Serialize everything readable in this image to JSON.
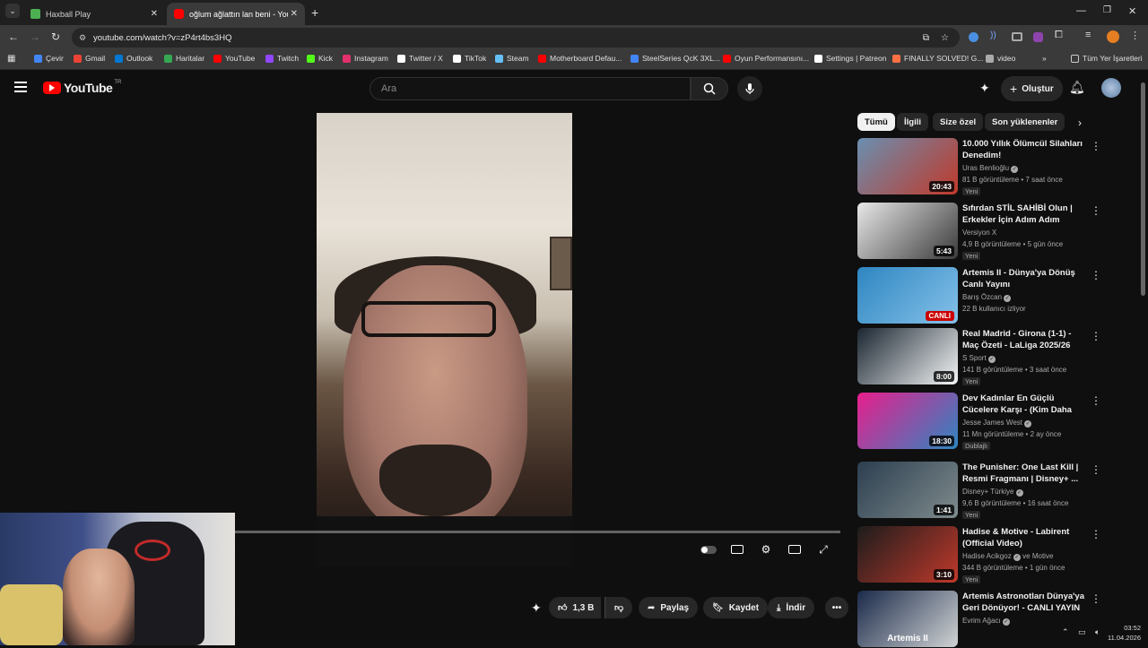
{
  "browser": {
    "tabs": [
      {
        "title": "Haxball Play",
        "color": "#4caf50"
      },
      {
        "title": "oğlum ağlattın lan beni - YouTube",
        "color": "#ff0000"
      }
    ],
    "url": "youtube.com/watch?v=zP4rt4bs3HQ",
    "bookmarks": [
      {
        "label": "Çevir",
        "color": "#4285f4"
      },
      {
        "label": "Gmail",
        "color": "#ea4335"
      },
      {
        "label": "Outlook",
        "color": "#0078d4"
      },
      {
        "label": "Haritalar",
        "color": "#34a853"
      },
      {
        "label": "YouTube",
        "color": "#ff0000"
      },
      {
        "label": "Twitch",
        "color": "#9146ff"
      },
      {
        "label": "Kick",
        "color": "#53fc18"
      },
      {
        "label": "Instagram",
        "color": "#e1306c"
      },
      {
        "label": "Twitter / X",
        "color": "#ffffff"
      },
      {
        "label": "TikTok",
        "color": "#ffffff"
      },
      {
        "label": "Steam",
        "color": "#66c0f4"
      },
      {
        "label": "Motherboard Defau...",
        "color": "#ff0000"
      },
      {
        "label": "SteelSeries QcK 3XL...",
        "color": "#4285f4"
      },
      {
        "label": "Oyun Performansını...",
        "color": "#ff0000"
      },
      {
        "label": "Settings | Patreon",
        "color": "#ffffff"
      },
      {
        "label": "FINALLY SOLVED! G...",
        "color": "#ff7043"
      },
      {
        "label": "video",
        "color": "#aaaaaa"
      }
    ],
    "all_bookmarks": "Tüm Yer İşaretleri",
    "more_bookmarks": "»"
  },
  "youtube": {
    "logo": "YouTube",
    "region": "TR",
    "search_placeholder": "Ara",
    "create_label": "Oluştur"
  },
  "video": {
    "like_count": "1,3 B",
    "share_label": "Paylaş",
    "save_label": "Kaydet",
    "download_label": "İndir",
    "progress": 0.0
  },
  "chips": [
    "Tümü",
    "İlgili",
    "Size özel",
    "Son yüklenenler"
  ],
  "recommendations": [
    {
      "title": "10.000 Yıllık Ölümcül Silahları Denedim!",
      "channel": "Uras Benlioğlu",
      "verified": true,
      "meta": "81 B görüntüleme • 7 saat önce",
      "badge": "Yeni",
      "duration": "20:43",
      "thumb_a": "#6a8fb0",
      "thumb_b": "#c0392b"
    },
    {
      "title": "Sıfırdan STİL SAHİBİ Olun | Erkekler İçin Adım Adım Giyim...",
      "channel": "Versiyon X",
      "verified": false,
      "meta": "4,9 B görüntüleme • 5 gün önce",
      "badge": "Yeni",
      "duration": "5:43",
      "thumb_a": "#e8e8e8",
      "thumb_b": "#3a3a3a"
    },
    {
      "title": "Artemis II - Dünya'ya Dönüş Canlı Yayını",
      "channel": "Barış Özcan",
      "verified": true,
      "meta": "22 B kullanıcı izliyor",
      "badge": "",
      "live": "CANLI",
      "thumb_a": "#2e86c1",
      "thumb_b": "#85c1e9"
    },
    {
      "title": "Real Madrid - Girona (1-1) - Maç Özeti - LaLiga 2025/26",
      "channel": "S Sport",
      "verified": true,
      "meta": "141 B görüntüleme • 3 saat önce",
      "badge": "Yeni",
      "duration": "8:00",
      "thumb_a": "#1b2631",
      "thumb_b": "#f4f6f7"
    },
    {
      "title": "Dev Kadınlar En Güçlü Cücelere Karşı - (Kim Daha Güçlü?)",
      "channel": "Jesse James West",
      "verified": true,
      "meta": "11 Mn görüntüleme • 2 ay önce",
      "badge": "Dublajlı",
      "duration": "18:30",
      "thumb_a": "#e91e8c",
      "thumb_b": "#2e86c1"
    },
    {
      "title": "The Punisher: One Last Kill | Resmi Fragmanı | Disney+ ...",
      "channel": "Disney+ Türkiye",
      "verified": true,
      "meta": "9,6 B görüntüleme • 16 saat önce",
      "badge": "Yeni",
      "duration": "1:41",
      "thumb_a": "#2c3e50",
      "thumb_b": "#7f8c8d"
    },
    {
      "title": "Hadise & Motive - Labirent (Official Video)",
      "channel": "Hadise Acikgoz",
      "channel2": "ve Motive",
      "verified": true,
      "meta": "344 B görüntüleme • 1 gün önce",
      "badge": "Yeni",
      "duration": "3:10",
      "thumb_a": "#1c1c1c",
      "thumb_b": "#c0392b"
    },
    {
      "title": "Artemis Astronotları Dünya'ya Geri Dönüyor! - CANLI YAYIN",
      "channel": "Evrim Ağacı",
      "verified": true,
      "meta": "",
      "badge": "",
      "overlay": "Artemis II",
      "thumb_a": "#1b2a4a",
      "thumb_b": "#d0d3d4"
    }
  ],
  "taskbar": {
    "time": "03:52",
    "date": "11.04.2026"
  }
}
